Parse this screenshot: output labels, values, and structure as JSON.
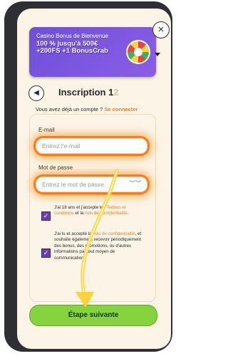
{
  "bonus": {
    "title": "Casino Bonus de Bienvenue",
    "offer": "100 % jusqu'à 500€ +200FS +1 BonusCrab"
  },
  "header": {
    "title": "Inscription",
    "step_current": "1",
    "step_total": "2"
  },
  "login_prompt": {
    "text": "Vous avez déjà un compte ?",
    "link": "Se connecter"
  },
  "form": {
    "email_label": "E-mail",
    "email_placeholder": "Entrez l'e-mail",
    "password_label": "Mot de passe",
    "password_placeholder": "Entrez le mot de passe"
  },
  "consent": {
    "age": {
      "checked": true,
      "text_a": "J'ai 18 ans et j'accepte les ",
      "link_a": "Termes et conditions",
      "text_b": " et la ",
      "link_b": "Avis de confidentialité",
      "text_c": "."
    },
    "marketing": {
      "checked": true,
      "text_a": "J'ai lu et accepté la ",
      "link_a": "Avis de confidentialité",
      "text_b": ", et souhaite également recevoir périodiquement des bonus, des promotions, ou d'autres informations par tout moyen de communication."
    }
  },
  "next_button": "Étape suivante",
  "colors": {
    "accent": "#e8852a",
    "highlight": "#ff7a1a",
    "button": "#84d33f",
    "checkbox": "#6b3fb0",
    "bonus_bg": "#7b56df"
  }
}
